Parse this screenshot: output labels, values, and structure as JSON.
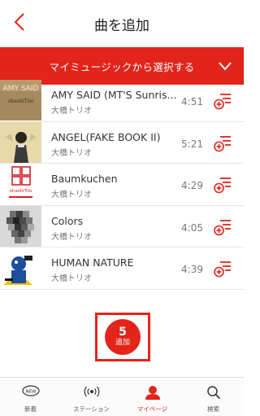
{
  "header": {
    "title": "曲を追加",
    "back_icon": "chevron-left-icon",
    "accent_color": "#e3241b"
  },
  "select_bar": {
    "label": "マイミュージックから選択する",
    "chevron_icon": "chevron-down-icon"
  },
  "tracks": [
    {
      "title": "AMY SAID (MT'S Sunris...",
      "artist": "大橋トリオ",
      "duration": "4:51",
      "cover_text": "AMY SAID",
      "cover_sub": "ohashiTrio"
    },
    {
      "title": "ANGEL(FAKE BOOK II)",
      "artist": "大橋トリオ",
      "duration": "5:21"
    },
    {
      "title": "Baumkuchen",
      "artist": "大橋トリオ",
      "duration": "4:29",
      "cover_text": "ohashiTrio"
    },
    {
      "title": "Colors",
      "artist": "大橋トリオ",
      "duration": "4:05"
    },
    {
      "title": "HUMAN NATURE",
      "artist": "大橋トリオ",
      "duration": "4:39"
    }
  ],
  "add_button": {
    "count": "5",
    "label": "追加"
  },
  "tabbar": {
    "items": [
      {
        "label": "新着",
        "icon": "new-badge-icon",
        "badge": "NEW",
        "active": false
      },
      {
        "label": "ステーション",
        "icon": "radio-waves-icon",
        "active": false
      },
      {
        "label": "マイページ",
        "icon": "person-icon",
        "active": true
      },
      {
        "label": "検索",
        "icon": "search-icon",
        "active": false
      }
    ]
  }
}
